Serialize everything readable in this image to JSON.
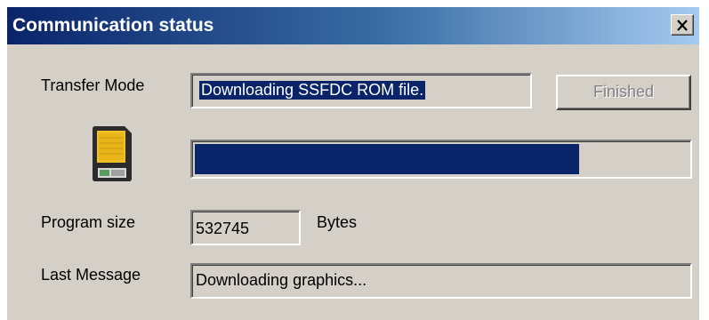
{
  "window": {
    "title": "Communication status",
    "close_glyph": "✕"
  },
  "transfer": {
    "label": "Transfer Mode",
    "value": "Downloading SSFDC ROM file."
  },
  "finished_button": {
    "label": "Finished",
    "enabled": false
  },
  "progress": {
    "fraction": 0.78,
    "color": "#0a246a"
  },
  "program": {
    "label": "Program size",
    "value": "532745",
    "unit": "Bytes"
  },
  "last_message": {
    "label": "Last Message",
    "value": "Downloading graphics..."
  },
  "icons": {
    "card": "smartmedia-card-icon",
    "close": "close-icon"
  }
}
